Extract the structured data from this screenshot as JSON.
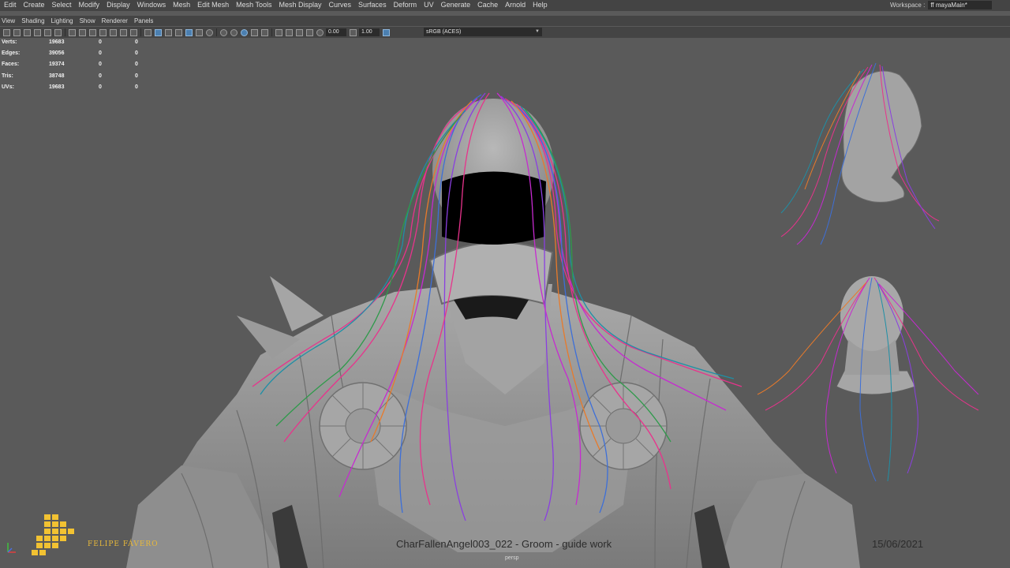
{
  "menubar": {
    "items": [
      "Edit",
      "Create",
      "Select",
      "Modify",
      "Display",
      "Windows",
      "Mesh",
      "Edit Mesh",
      "Mesh Tools",
      "Mesh Display",
      "Curves",
      "Surfaces",
      "Deform",
      "UV",
      "Generate",
      "Cache",
      "Arnold",
      "Help"
    ],
    "workspace_label": "Workspace :",
    "workspace_value": "ff mayaMain*"
  },
  "panel_menu": {
    "items": [
      "View",
      "Shading",
      "Lighting",
      "Show",
      "Renderer",
      "Panels"
    ]
  },
  "toolbar": {
    "exposure": "0.00",
    "gamma": "1.00",
    "colorspace": "sRGB (ACES)"
  },
  "hud": {
    "rows": [
      {
        "label": "Verts:",
        "v1": "19683",
        "v2": "0",
        "v3": "0"
      },
      {
        "label": "Edges:",
        "v1": "39056",
        "v2": "0",
        "v3": "0"
      },
      {
        "label": "Faces:",
        "v1": "19374",
        "v2": "0",
        "v3": "0"
      },
      {
        "label": "Tris:",
        "v1": "38748",
        "v2": "0",
        "v3": "0"
      },
      {
        "label": "UVs:",
        "v1": "19683",
        "v2": "0",
        "v3": "0"
      }
    ]
  },
  "overlay": {
    "brand": "FELIPE FÁVERO",
    "caption": "CharFallenAngel003_022 - Groom - guide work",
    "date": "15/06/2021",
    "camera": "persp"
  },
  "colors": {
    "hair": [
      "#e8338c",
      "#c62ad0",
      "#3d6fd8",
      "#1f8fa6",
      "#e87a2a",
      "#8a3fe0",
      "#2e9a4a"
    ],
    "brand": "#e8b93a"
  }
}
